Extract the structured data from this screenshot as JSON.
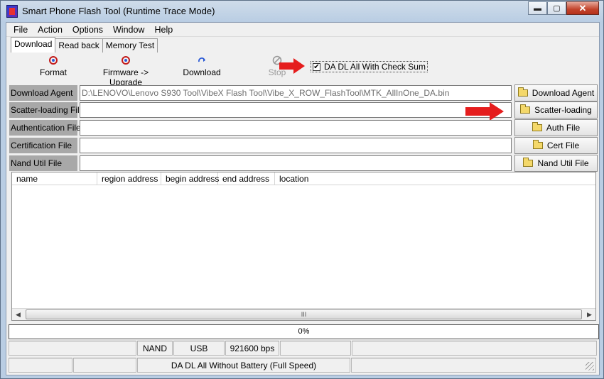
{
  "window": {
    "title": "Smart Phone Flash Tool (Runtime Trace Mode)",
    "controls": {
      "minimize": "▬",
      "maximize": "▢",
      "close": "✕"
    }
  },
  "menu": [
    "File",
    "Action",
    "Options",
    "Window",
    "Help"
  ],
  "tabs": [
    "Download",
    "Read back",
    "Memory Test"
  ],
  "toolbar": {
    "format": "Format",
    "firmware_upgrade": "Firmware -> Upgrade",
    "download": "Download",
    "stop": "Stop",
    "checksum_label": "DA DL All With Check Sum",
    "checksum_checked": true
  },
  "form": {
    "download_agent": {
      "label": "Download Agent",
      "value": "D:\\LENOVO\\Lenovo S930 Tool\\VibeX Flash Tool\\Vibe_X_ROW_FlashTool\\MTK_AllInOne_DA.bin",
      "button": "Download Agent"
    },
    "scatter": {
      "label": "Scatter-loading File",
      "value": "",
      "button": "Scatter-loading"
    },
    "auth": {
      "label": "Authentication File",
      "value": "",
      "button": "Auth File"
    },
    "cert": {
      "label": "Certification File",
      "value": "",
      "button": "Cert File"
    },
    "nand": {
      "label": "Nand Util File",
      "value": "",
      "button": "Nand Util File"
    }
  },
  "table": {
    "columns": [
      "name",
      "region address",
      "begin address",
      "end address",
      "location"
    ],
    "scroll_grip": "III"
  },
  "progress": {
    "value": 0,
    "text": "0%"
  },
  "status": {
    "row1": [
      "",
      "NAND",
      "USB",
      "921600 bps",
      "",
      ""
    ],
    "row2": [
      "",
      "",
      "DA DL All Without Battery (Full Speed)",
      ""
    ]
  },
  "colors": {
    "arrow": "#e51d1d",
    "label_bg": "#a8a8a8"
  },
  "icons": {
    "format": "format-icon",
    "firmware": "firmware-upgrade-icon",
    "download": "download-icon",
    "stop": "stop-icon",
    "folder": "folder-icon"
  }
}
